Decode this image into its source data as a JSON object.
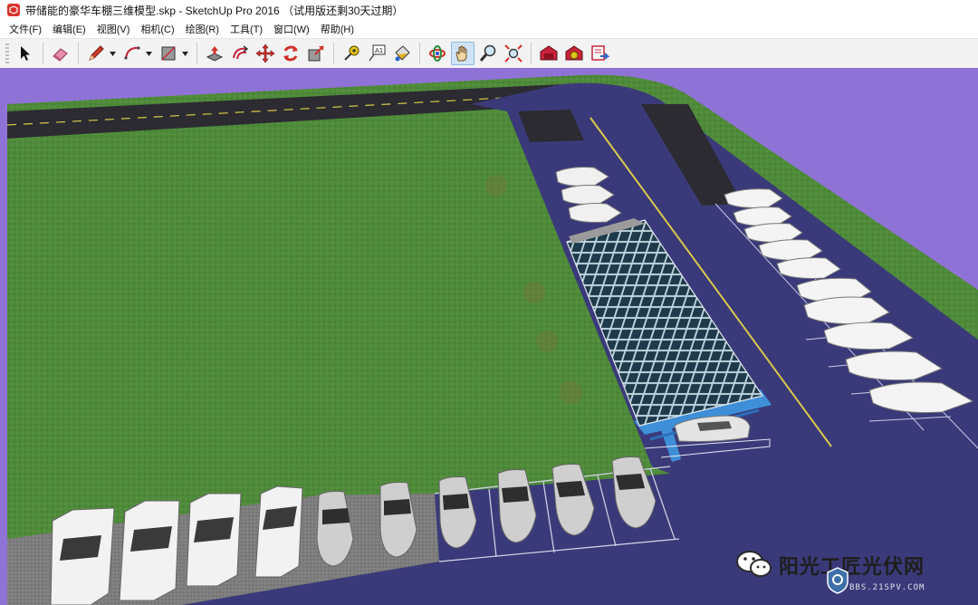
{
  "window": {
    "title": "带储能的豪华车棚三维模型.skp - SketchUp Pro 2016 （试用版还剩30天过期）"
  },
  "menu": {
    "items": [
      {
        "id": "file",
        "label": "文件(F)"
      },
      {
        "id": "edit",
        "label": "编辑(E)"
      },
      {
        "id": "view",
        "label": "视图(V)"
      },
      {
        "id": "camera",
        "label": "相机(C)"
      },
      {
        "id": "draw",
        "label": "绘图(R)"
      },
      {
        "id": "tools",
        "label": "工具(T)"
      },
      {
        "id": "window",
        "label": "窗口(W)"
      },
      {
        "id": "help",
        "label": "帮助(H)"
      }
    ]
  },
  "toolbar": {
    "tools": [
      {
        "name": "select-tool-button",
        "icon": "arrow-cursor-icon"
      },
      {
        "name": "eraser-tool-button",
        "icon": "eraser-icon"
      },
      {
        "name": "line-tool-button",
        "icon": "pencil-icon"
      },
      {
        "name": "arc-tool-button",
        "icon": "arc-icon"
      },
      {
        "name": "rectangle-tool-button",
        "icon": "rectangle-icon"
      },
      {
        "name": "push-pull-tool-button",
        "icon": "push-pull-icon"
      },
      {
        "name": "offset-tool-button",
        "icon": "offset-icon"
      },
      {
        "name": "move-tool-button",
        "icon": "move-icon"
      },
      {
        "name": "rotate-tool-button",
        "icon": "rotate-icon"
      },
      {
        "name": "scale-tool-button",
        "icon": "scale-icon"
      },
      {
        "name": "tape-measure-tool-button",
        "icon": "tape-measure-icon"
      },
      {
        "name": "text-tool-button",
        "icon": "text-icon"
      },
      {
        "name": "paint-bucket-tool-button",
        "icon": "paint-bucket-icon"
      },
      {
        "name": "orbit-tool-button",
        "icon": "orbit-icon"
      },
      {
        "name": "pan-tool-button",
        "icon": "hand-icon",
        "active": true
      },
      {
        "name": "zoom-tool-button",
        "icon": "magnifier-icon"
      },
      {
        "name": "zoom-extents-tool-button",
        "icon": "zoom-extents-icon"
      },
      {
        "name": "warehouse-button",
        "icon": "warehouse-icon"
      },
      {
        "name": "extension-warehouse-button",
        "icon": "extension-warehouse-icon"
      },
      {
        "name": "send-to-layout-button",
        "icon": "layout-icon"
      }
    ]
  },
  "watermark": {
    "brand": "阳光工匠光伏网",
    "site": "BBS.21SPV.COM",
    "icons": [
      "wechat-icon",
      "shield-logo-icon"
    ]
  },
  "colors": {
    "sky": "#8f72d6",
    "grass": "#4e8a3a",
    "asphalt": "#3a3a7a",
    "road": "#2e2e36",
    "solar_panel": "#1f3a4a",
    "carport_frame": "#3f8fd8"
  }
}
